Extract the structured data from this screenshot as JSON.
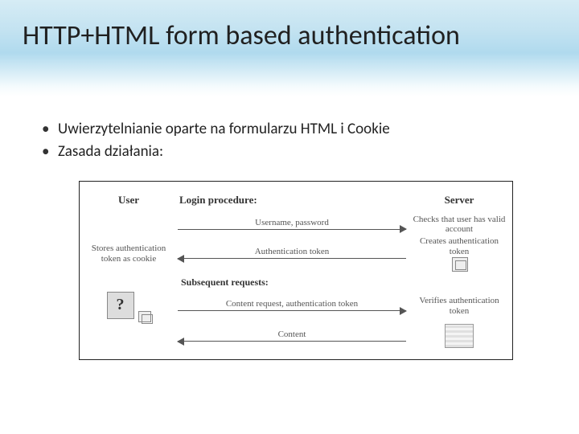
{
  "title": "HTTP+HTML form based authentication",
  "bullets": [
    "Uwierzytelnianie oparte na formularzu HTML i Cookie",
    "Zasada działania:"
  ],
  "diagram": {
    "headers": {
      "user": "User",
      "login": "Login procedure:",
      "server": "Server",
      "subsequent": "Subsequent requests:"
    },
    "step1": {
      "caption": "Username, password",
      "right_note": "Checks that user has valid account"
    },
    "step2": {
      "caption": "Authentication token",
      "left_note": "Stores authentication token as cookie",
      "right_note": "Creates authentication token"
    },
    "step3": {
      "caption": "Content request, authentication token",
      "right_note": "Verifies authentication token"
    },
    "step4": {
      "caption": "Content"
    }
  }
}
